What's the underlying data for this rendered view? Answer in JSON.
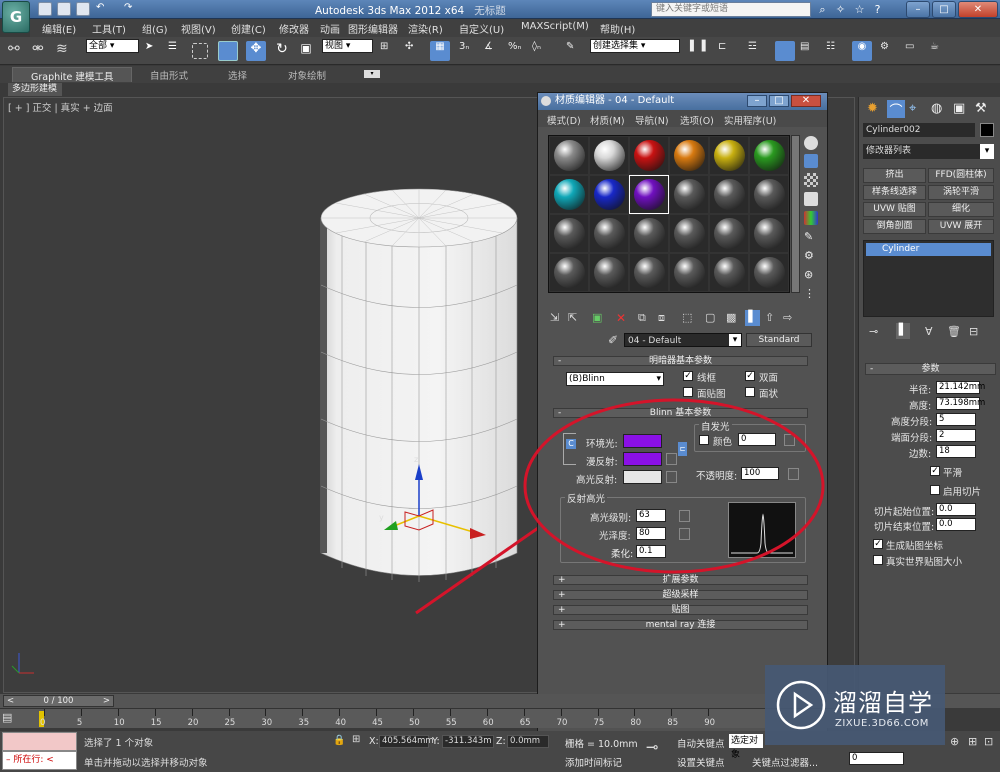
{
  "app": {
    "title": "Autodesk 3ds Max  2012 x64",
    "doc": "无标题",
    "search_placeholder": "键入关键字或短语",
    "app_icon_glyph": "G"
  },
  "menu": [
    "编辑(E)",
    "工具(T)",
    "组(G)",
    "视图(V)",
    "创建(C)",
    "修改器",
    "动画",
    "图形编辑器",
    "渲染(R)",
    "自定义(U)",
    "MAXScript(M)",
    "帮助(H)"
  ],
  "toolbar": {
    "selection_filter": "全部",
    "ref_coord": "视图",
    "named_sel": "创建选择集"
  },
  "ribbon": {
    "tabs": [
      "Graphite 建模工具",
      "自由形式",
      "选择",
      "对象绘制"
    ],
    "subtab": "多边形建模"
  },
  "viewport": {
    "label": "[ + ] 正交 | 真实 + 边面",
    "bg": "#3d3d3d"
  },
  "material_editor": {
    "title": "材质编辑器 - 04 - Default",
    "menu": [
      "模式(D)",
      "材质(M)",
      "导航(N)",
      "选项(O)",
      "实用程序(U)"
    ],
    "slot_colors": [
      "#8a8a8a",
      "#d8d8d8",
      "#c81212",
      "#d87a10",
      "#c8b010",
      "#2a9a20",
      "#10a8b8",
      "#1828c8",
      "#7010c0",
      "#5a5a5a",
      "#5a5a5a",
      "#5a5a5a",
      "#5a5a5a",
      "#5a5a5a",
      "#5a5a5a",
      "#5a5a5a",
      "#5a5a5a",
      "#5a5a5a",
      "#5a5a5a",
      "#5a5a5a",
      "#5a5a5a",
      "#5a5a5a",
      "#5a5a5a",
      "#5a5a5a"
    ],
    "material_name": "04 - Default",
    "material_type": "Standard",
    "shader_rollout": {
      "title": "明暗器基本参数",
      "shader": "(B)Blinn",
      "wire": "线框",
      "two_sided": "双面",
      "face_map": "面贴图",
      "faceted": "面状"
    },
    "blinn_rollout": {
      "title": "Blinn 基本参数",
      "ambient": "环境光:",
      "diffuse": "漫反射:",
      "specular": "高光反射:",
      "ambient_color": "#8a10e6",
      "diffuse_color": "#8a10e6",
      "specular_color": "#e6e6e6",
      "self_illum_title": "自发光",
      "color_label": "颜色",
      "self_illum_value": "0",
      "opacity_label": "不透明度:",
      "opacity_value": "100",
      "spec_title": "反射高光",
      "spec_level_label": "高光级别:",
      "spec_level": "63",
      "gloss_label": "光泽度:",
      "gloss": "80",
      "soften_label": "柔化:",
      "soften": "0.1",
      "lock_glyph": "C"
    },
    "rollouts": [
      "扩展参数",
      "超级采样",
      "贴图",
      "mental ray 连接"
    ]
  },
  "command_panel": {
    "object_name": "Cylinder002",
    "modifier_list": "修改器列表",
    "buttons": [
      "挤出",
      "FFD(圆柱体)",
      "样条线选择",
      "涡轮平滑",
      "UVW 贴图",
      "细化",
      "倒角剖面",
      "UVW 展开"
    ],
    "stack_item": "Cylinder",
    "params_title": "参数",
    "radius_label": "半径:",
    "radius": "21.142mm",
    "height_label": "高度:",
    "height": "73.198mm",
    "height_segs_label": "高度分段:",
    "height_segs": "5",
    "cap_segs_label": "端面分段:",
    "cap_segs": "2",
    "sides_label": "边数:",
    "sides": "18",
    "smooth": "平滑",
    "slice_on": "启用切片",
    "slice_from_label": "切片起始位置:",
    "slice_from": "0.0",
    "slice_to_label": "切片结束位置:",
    "slice_to": "0.0",
    "gen_map": "生成贴图坐标",
    "real_world": "真实世界贴图大小"
  },
  "timeline": {
    "frame": "0 / 100",
    "ticks": [
      "0",
      "5",
      "10",
      "15",
      "20",
      "25",
      "30",
      "35",
      "40",
      "45",
      "50",
      "55",
      "60",
      "65",
      "70",
      "75",
      "80",
      "85",
      "90"
    ]
  },
  "status": {
    "script_label": "所在行:",
    "selected": "选择了 1 个对象",
    "prompt": "单击并拖动以选择并移动对象",
    "x_label": "X:",
    "x": "405.564mm",
    "y_label": "Y:",
    "y": "-311.343m",
    "z_label": "Z:",
    "z": "0.0mm",
    "grid": "栅格 = 10.0mm",
    "add_time_tag": "添加时间标记",
    "auto_key": "自动关键点",
    "selected_set": "选定对象",
    "set_key": "设置关键点",
    "key_filters": "关键点过滤器...",
    "frame": "0"
  },
  "watermark": {
    "name": "溜溜自学",
    "url": "ZIXUE.3D66.COM"
  }
}
